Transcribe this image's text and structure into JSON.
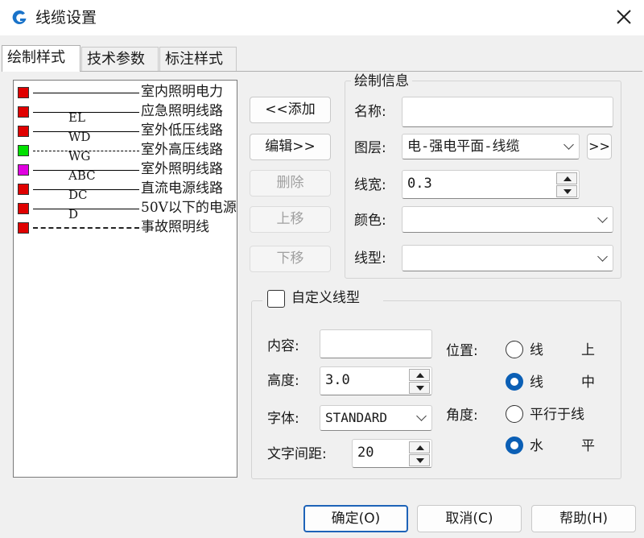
{
  "window": {
    "title": "线缆设置"
  },
  "tabs": [
    {
      "label": "绘制样式",
      "active": true
    },
    {
      "label": "技术参数",
      "active": false
    },
    {
      "label": "标注样式",
      "active": false
    }
  ],
  "list": {
    "rows": [
      {
        "name": "室内照明电力",
        "code": "",
        "color": "#e00000",
        "line": "solid"
      },
      {
        "name": "应急照明线路",
        "code": "EL",
        "color": "#e00000",
        "line": "solid"
      },
      {
        "name": "室外低压线路",
        "code": "WD",
        "color": "#e00000",
        "line": "solid"
      },
      {
        "name": "室外高压线路",
        "code": "WG",
        "color": "#00e000",
        "line": "dashdot"
      },
      {
        "name": "室外照明线路",
        "code": "ABC",
        "color": "#e000e0",
        "line": "solid"
      },
      {
        "name": "直流电源线路",
        "code": "DC",
        "color": "#e00000",
        "line": "solid"
      },
      {
        "name": "50V以下的电源",
        "code": "D",
        "color": "#e00000",
        "line": "solid"
      },
      {
        "name": "事故照明线",
        "code": "",
        "color": "#e00000",
        "line": "dashed"
      }
    ]
  },
  "buttons": {
    "add": "<<添加",
    "edit": "编辑>>",
    "delete": "删除",
    "move_up": "上移",
    "move_down": "下移",
    "layer_more": ">>"
  },
  "draw_info": {
    "legend": "绘制信息",
    "name_label": "名称:",
    "name_value": "",
    "layer_label": "图层:",
    "layer_value": "电-强电平面-线缆",
    "width_label": "线宽:",
    "width_value": "0.3",
    "color_label": "颜色:",
    "color_value": "",
    "linetype_label": "线型:",
    "linetype_value": ""
  },
  "custom": {
    "checkbox_label": "自定义线型",
    "checked": false,
    "content_label": "内容:",
    "content_value": "",
    "height_label": "高度:",
    "height_value": "3.0",
    "font_label": "字体:",
    "font_value": "STANDARD",
    "spacing_label": "文字间距:",
    "spacing_value": "20",
    "position_label": "位置:",
    "pos_above_a": "线",
    "pos_above_b": "上",
    "pos_middle_a": "线",
    "pos_middle_b": "中",
    "angle_label": "角度:",
    "angle_parallel": "平行于线",
    "angle_horizontal_a": "水",
    "angle_horizontal_b": "平",
    "position_selected": "middle",
    "angle_selected": "horizontal"
  },
  "footer": {
    "ok": "确定(O)",
    "cancel": "取消(C)",
    "help": "帮助(H)"
  },
  "colors": {
    "accent": "#0b5fb5",
    "icon_blue": "#1a73c9"
  },
  "icons": {
    "app": "app-logo-icon",
    "close": "close-icon"
  }
}
